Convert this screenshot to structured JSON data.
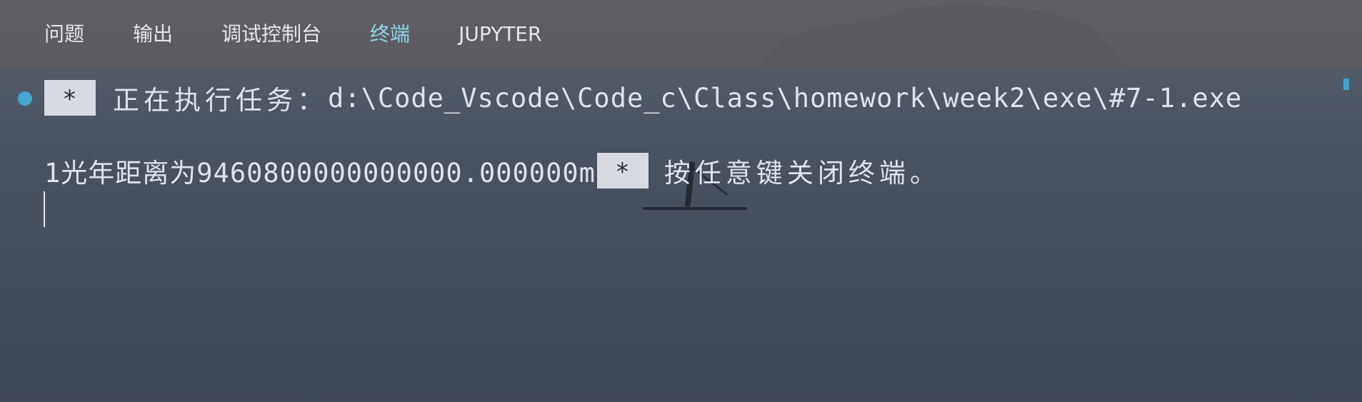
{
  "panel": {
    "tabs": [
      {
        "label": "问题",
        "active": false
      },
      {
        "label": "输出",
        "active": false
      },
      {
        "label": "调试控制台",
        "active": false
      },
      {
        "label": "终端",
        "active": true
      },
      {
        "label": "JUPYTER",
        "active": false
      }
    ]
  },
  "terminal": {
    "task_line": {
      "marker": "*",
      "prefix": "正在执行任务：",
      "path": "d:\\Code_Vscode\\Code_c\\Class\\homework\\week2\\exe\\#7-1.exe"
    },
    "output_line": {
      "text": "1光年距离为9460800000000000.000000m",
      "marker": "*",
      "prompt": "按任意键关闭终端。"
    }
  },
  "colors": {
    "active_tab": "#8fd6e8",
    "status_dot": "#45a6cf",
    "badge_bg": "#d7dbe1"
  }
}
